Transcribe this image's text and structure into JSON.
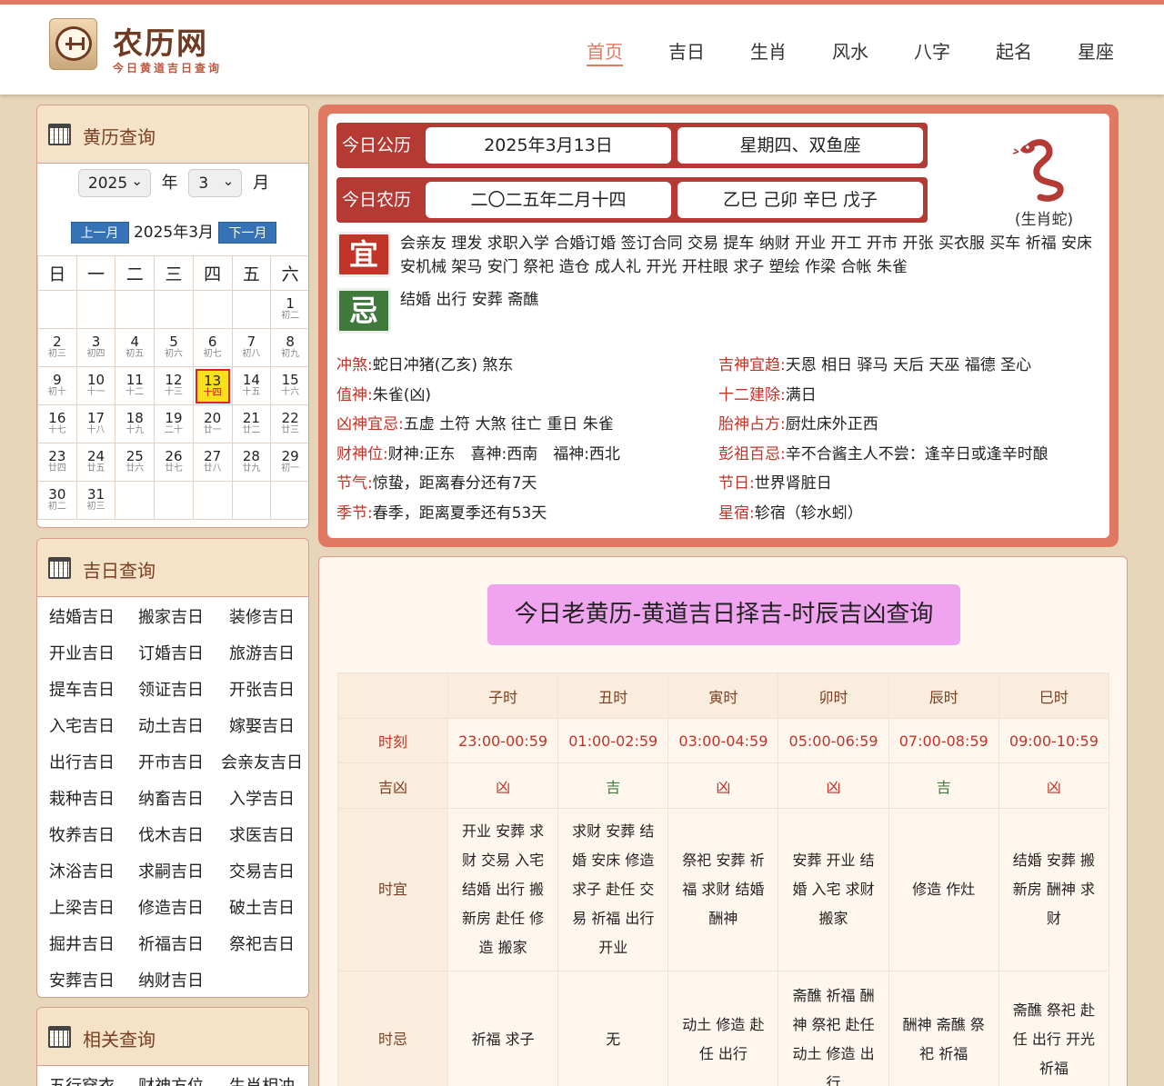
{
  "site": {
    "title": "农历网",
    "subtitle": "今日黄道吉日查询"
  },
  "nav": [
    "首页",
    "吉日",
    "生肖",
    "风水",
    "八字",
    "起名",
    "星座"
  ],
  "nav_active": 0,
  "calendar": {
    "panel_title": "黄历查询",
    "year": "2025",
    "year_unit": "年",
    "month": "3",
    "month_unit": "月",
    "prev": "上一月",
    "next": "下一月",
    "current": "2025年3月",
    "weekdays": [
      "日",
      "一",
      "二",
      "三",
      "四",
      "五",
      "六"
    ],
    "weeks": [
      [
        null,
        null,
        null,
        null,
        null,
        null,
        {
          "d": "1",
          "l": "初二"
        }
      ],
      [
        {
          "d": "2",
          "l": "初三"
        },
        {
          "d": "3",
          "l": "初四"
        },
        {
          "d": "4",
          "l": "初五"
        },
        {
          "d": "5",
          "l": "初六"
        },
        {
          "d": "6",
          "l": "初七"
        },
        {
          "d": "7",
          "l": "初八"
        },
        {
          "d": "8",
          "l": "初九"
        }
      ],
      [
        {
          "d": "9",
          "l": "初十"
        },
        {
          "d": "10",
          "l": "十一"
        },
        {
          "d": "11",
          "l": "十二"
        },
        {
          "d": "12",
          "l": "十三"
        },
        {
          "d": "13",
          "l": "十四",
          "today": true
        },
        {
          "d": "14",
          "l": "十五"
        },
        {
          "d": "15",
          "l": "十六"
        }
      ],
      [
        {
          "d": "16",
          "l": "十七"
        },
        {
          "d": "17",
          "l": "十八"
        },
        {
          "d": "18",
          "l": "十九"
        },
        {
          "d": "19",
          "l": "二十"
        },
        {
          "d": "20",
          "l": "廿一"
        },
        {
          "d": "21",
          "l": "廿二"
        },
        {
          "d": "22",
          "l": "廿三"
        }
      ],
      [
        {
          "d": "23",
          "l": "廿四"
        },
        {
          "d": "24",
          "l": "廿五"
        },
        {
          "d": "25",
          "l": "廿六"
        },
        {
          "d": "26",
          "l": "廿七"
        },
        {
          "d": "27",
          "l": "廿八"
        },
        {
          "d": "28",
          "l": "廿九"
        },
        {
          "d": "29",
          "l": "初一"
        }
      ],
      [
        {
          "d": "30",
          "l": "初二"
        },
        {
          "d": "31",
          "l": "初三"
        },
        null,
        null,
        null,
        null,
        null
      ]
    ]
  },
  "jiri": {
    "panel_title": "吉日查询",
    "items": [
      "结婚吉日",
      "搬家吉日",
      "装修吉日",
      "开业吉日",
      "订婚吉日",
      "旅游吉日",
      "提车吉日",
      "领证吉日",
      "开张吉日",
      "入宅吉日",
      "动土吉日",
      "嫁娶吉日",
      "出行吉日",
      "开市吉日",
      "会亲友吉日",
      "栽种吉日",
      "纳畜吉日",
      "入学吉日",
      "牧养吉日",
      "伐木吉日",
      "求医吉日",
      "沐浴吉日",
      "求嗣吉日",
      "交易吉日",
      "上梁吉日",
      "修造吉日",
      "破土吉日",
      "掘井吉日",
      "祈福吉日",
      "祭祀吉日",
      "安葬吉日",
      "纳财吉日"
    ]
  },
  "related": {
    "panel_title": "相关查询",
    "items": [
      "五行穿衣",
      "财神方位",
      "生肖相冲"
    ]
  },
  "today": {
    "gongli_label": "今日公历",
    "gongli_date": "2025年3月13日",
    "gongli_week": "星期四、双鱼座",
    "nongli_label": "今日农历",
    "nongli_date": "二〇二五年二月十四",
    "ganzhi": "乙巳 己卯 辛巳 戊子",
    "zodiac_label": "(生肖蛇)",
    "yi_char": "宜",
    "yi": "会亲友 理发 求职入学 合婚订婚 签订合同 交易 提车 纳财 开业 开工 开市 开张 买衣服 买车 祈福 安床 安机械 架马 安门 祭祀 造仓 成人礼 开光 开柱眼 求子 塑绘 作梁 合帐 朱雀",
    "ji_char": "忌",
    "ji": "结婚 出行 安葬 斋醮",
    "info_left": [
      {
        "k": "冲煞:",
        "v": "蛇日冲猪(乙亥) 煞东"
      },
      {
        "k": "值神:",
        "v": "朱雀(凶)"
      },
      {
        "k": "凶神宜忌:",
        "v": "五虚 土符 大煞 往亡 重日 朱雀"
      },
      {
        "k": "财神位:",
        "v": "财神:正东　喜神:西南　福神:西北"
      },
      {
        "k": "节气:",
        "v": "惊蛰，距离春分还有7天"
      },
      {
        "k": "季节:",
        "v": "春季，距离夏季还有53天"
      }
    ],
    "info_right": [
      {
        "k": "吉神宜趋:",
        "v": "天恩 相日 驿马 天后 天巫 福德 圣心"
      },
      {
        "k": "十二建除:",
        "v": "满日"
      },
      {
        "k": "胎神占方:",
        "v": "厨灶床外正西"
      },
      {
        "k": "彭祖百忌:",
        "v": "辛不合酱主人不尝：逢辛日或逢辛时酿"
      },
      {
        "k": "节日:",
        "v": "世界肾脏日"
      },
      {
        "k": "星宿:",
        "v": "轸宿（轸水蚓）"
      }
    ]
  },
  "shichen": {
    "title": "今日老黄历-黄道吉日择吉-时辰吉凶查询",
    "row_labels": [
      "时刻",
      "吉凶",
      "时宜",
      "时忌"
    ],
    "columns": [
      {
        "name": "子时",
        "time": "23:00-00:59",
        "jx": "凶",
        "yi": "开业 安葬 求财 交易 入宅 结婚 出行 搬新房 赴任 修造 搬家",
        "ji": "祈福 求子"
      },
      {
        "name": "丑时",
        "time": "01:00-02:59",
        "jx": "吉",
        "yi": "求财 安葬 结婚 安床 修造 求子 赴任 交易 祈福 出行 开业",
        "ji": "无"
      },
      {
        "name": "寅时",
        "time": "03:00-04:59",
        "jx": "凶",
        "yi": "祭祀 安葬 祈福 求财 结婚 酬神",
        "ji": "动土 修造 赴任 出行"
      },
      {
        "name": "卯时",
        "time": "05:00-06:59",
        "jx": "凶",
        "yi": "安葬 开业 结婚 入宅 求财 搬家",
        "ji": "斋醮 祈福 酬神 祭祀 赴任 动土 修造 出行"
      },
      {
        "name": "辰时",
        "time": "07:00-08:59",
        "jx": "吉",
        "yi": "修造 作灶",
        "ji": "酬神 斋醮 祭祀 祈福"
      },
      {
        "name": "巳时",
        "time": "09:00-10:59",
        "jx": "凶",
        "yi": "结婚 安葬 搬新房 酬神 求财",
        "ji": "斋醮 祭祀 赴任 出行 开光 祈福"
      }
    ]
  },
  "colors": {
    "accent": "#e07862",
    "red": "#c23328",
    "green": "#3f7a3c",
    "title_bg": "#f0a4f0"
  }
}
